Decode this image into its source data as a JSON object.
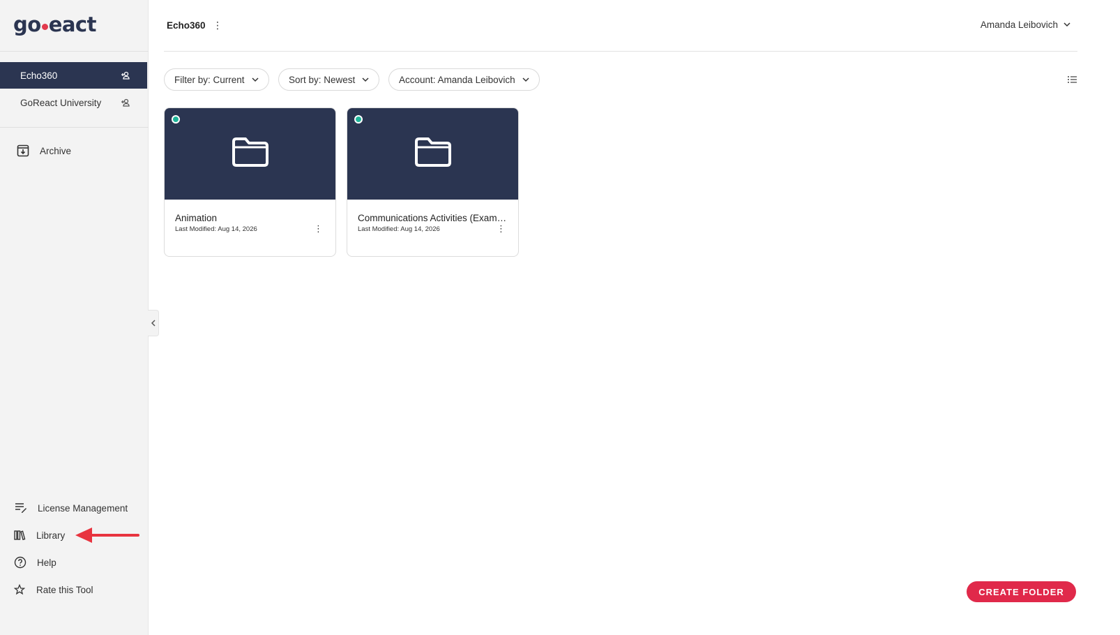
{
  "brand": {
    "logo_left": "go",
    "logo_right": "eact",
    "logo_mid": "r"
  },
  "sidebar": {
    "workspaces": [
      {
        "label": "Echo360",
        "active": true
      },
      {
        "label": "GoReact University",
        "active": false
      }
    ],
    "archive_label": "Archive",
    "bottom_nav": [
      {
        "label": "License Management",
        "icon": "license-edit-icon"
      },
      {
        "label": "Library",
        "icon": "library-books-icon"
      },
      {
        "label": "Help",
        "icon": "help-circle-icon"
      },
      {
        "label": "Rate this Tool",
        "icon": "star-icon"
      }
    ]
  },
  "header": {
    "workspace_title": "Echo360",
    "user_name": "Amanda Leibovich"
  },
  "toolbar": {
    "filter_label": "Filter by: Current",
    "sort_label": "Sort by: Newest",
    "account_label": "Account: Amanda Leibovich"
  },
  "folders": [
    {
      "name": "Animation",
      "modified": "Last Modified: Aug 14, 2026"
    },
    {
      "name": "Communications Activities (Example)",
      "modified": "Last Modified: Aug 14, 2026"
    }
  ],
  "actions": {
    "create_folder": "CREATE FOLDER"
  },
  "colors": {
    "navy": "#2b3551",
    "accent_red": "#e0294a",
    "status_green": "#1fb59a"
  }
}
